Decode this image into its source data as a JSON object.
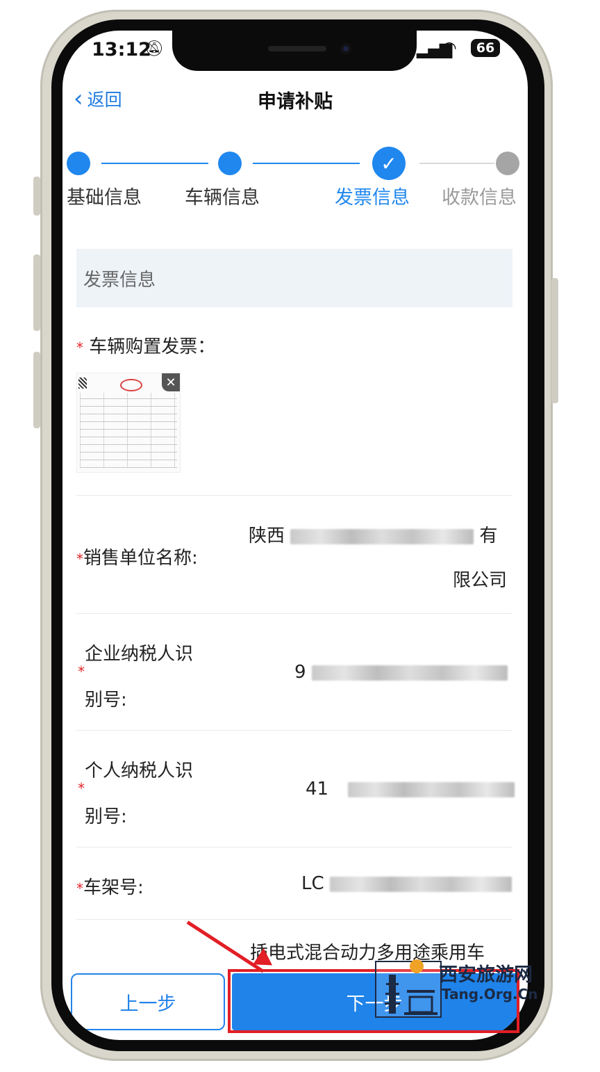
{
  "status_bar": {
    "time": "13:12",
    "battery": "66"
  },
  "nav": {
    "back_label": "返回",
    "title": "申请补贴"
  },
  "steps": [
    {
      "label": "基础信息",
      "state": "done"
    },
    {
      "label": "车辆信息",
      "state": "done"
    },
    {
      "label": "发票信息",
      "state": "active"
    },
    {
      "label": "收款信息",
      "state": "todo"
    }
  ],
  "section_title": "发票信息",
  "fields": {
    "invoice": {
      "label": "车辆购置发票："
    },
    "seller": {
      "label": "销售单位名称:",
      "value_prefix": "陕西",
      "value_end": "有",
      "value_line2": "限公司"
    },
    "company_tax": {
      "label_line1": "企业纳税人识",
      "label_line2": "别号:",
      "value_prefix": "9"
    },
    "personal_tax": {
      "label_line1": "个人纳税人识",
      "label_line2": "别号:",
      "value_prefix": "41"
    },
    "vin": {
      "label": "车架号:",
      "value_prefix": "LC"
    },
    "vehicle_type": {
      "value": "插电式混合动力多用途乘用车"
    }
  },
  "required_mark": "*",
  "footer": {
    "prev_label": "上一步",
    "next_label": "下一步"
  },
  "watermark": {
    "cn": "西安旅游网",
    "en": "Tang.Org.Cn"
  },
  "colors": {
    "accent": "#1f87ee",
    "highlight": "#e21e26",
    "required": "#e3262b"
  }
}
